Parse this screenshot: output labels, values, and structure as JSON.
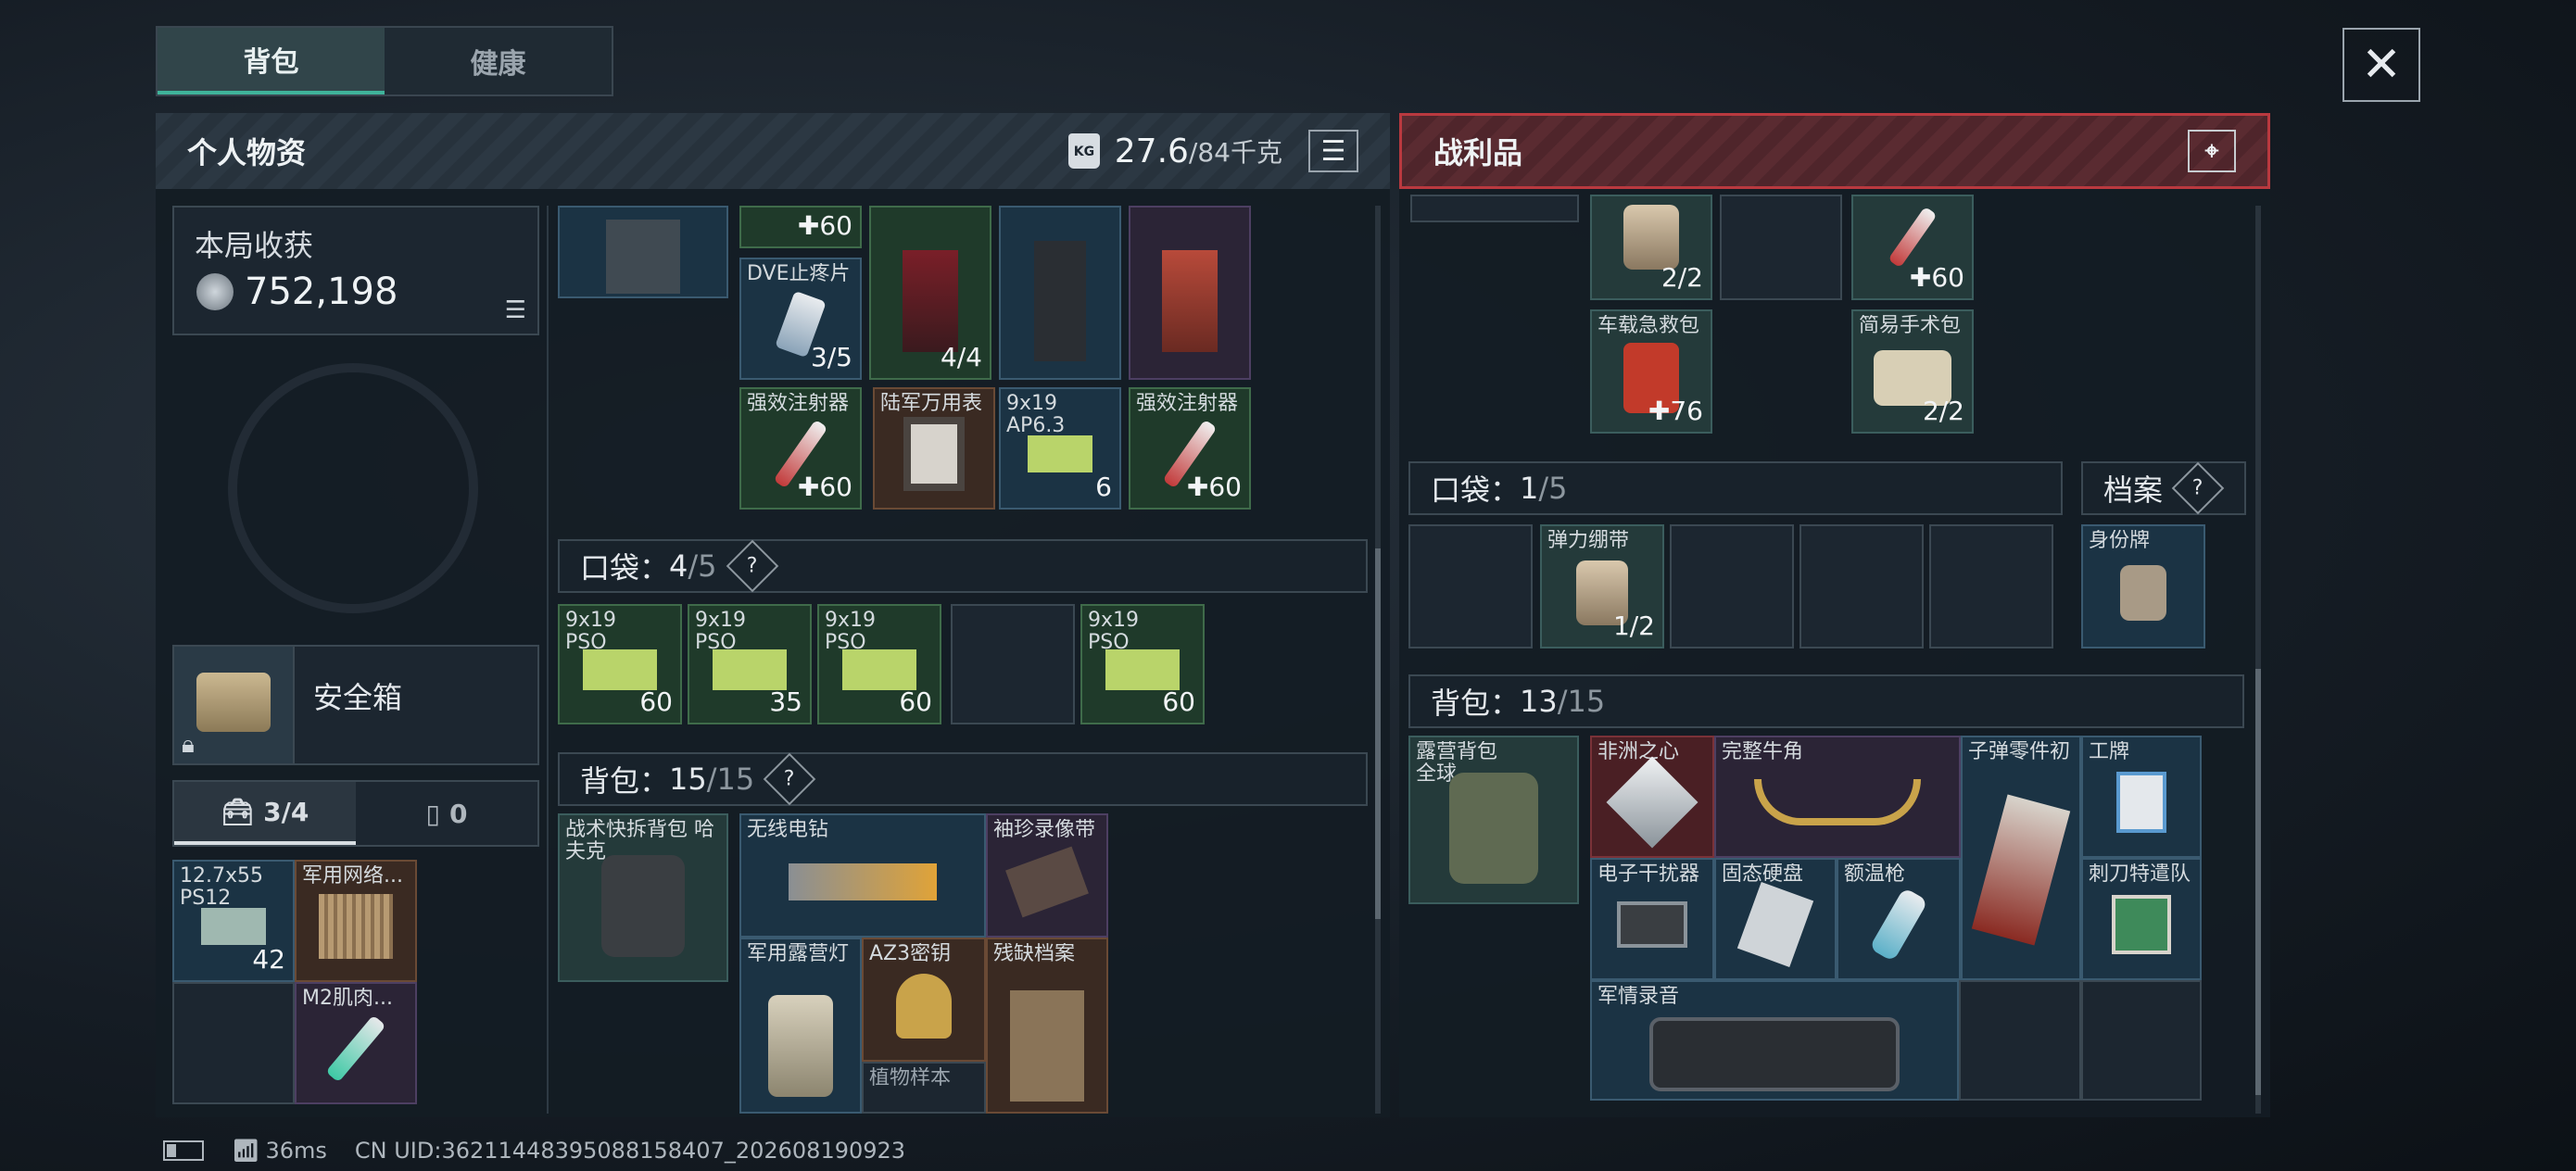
{
  "tabs": [
    {
      "label": "背包"
    },
    {
      "label": "健康"
    }
  ],
  "left_panel": {
    "title": "个人物资",
    "weight_value": "27.6",
    "weight_max": "/84千克"
  },
  "right_panel": {
    "title": "战利品"
  },
  "earnings": {
    "label": "本局收获",
    "value": "752,198"
  },
  "safebox": {
    "label": "安全箱"
  },
  "subtabs": {
    "a": "3/4",
    "b": "0"
  },
  "left_pocket": {
    "label": "口袋：",
    "count": "4",
    "max": "/5"
  },
  "left_backpack": {
    "label": "背包：",
    "count": "15",
    "max": "/15"
  },
  "right_pocket": {
    "label": "口袋：",
    "count": "1",
    "max": "/5"
  },
  "right_archive": {
    "label": "档案"
  },
  "right_backpack": {
    "label": "背包：",
    "count": "13",
    "max": "/15"
  },
  "left_items": [
    {
      "label": "",
      "count": "60"
    },
    {
      "label": "DVE止疼片",
      "count": "3/5"
    },
    {
      "label": "",
      "count": "4/4"
    },
    {
      "label": "强效注射器",
      "count": "60"
    },
    {
      "label": "陆军万用表",
      "count": ""
    },
    {
      "label": "9x19 AP6.3",
      "count": "6"
    },
    {
      "label": "强效注射器",
      "count": "60"
    }
  ],
  "pocket_items": [
    {
      "label": "9x19 PSO",
      "count": "60"
    },
    {
      "label": "9x19 PSO",
      "count": "35"
    },
    {
      "label": "9x19 PSO",
      "count": "60"
    },
    {
      "label": "",
      "count": ""
    },
    {
      "label": "9x19 PSO",
      "count": "60"
    }
  ],
  "backpack_items": [
    {
      "label": "战术快拆背包 哈夫克"
    },
    {
      "label": "无线电钻"
    },
    {
      "label": "袖珍录像带"
    },
    {
      "label": "军用露营灯"
    },
    {
      "label": "AZ3密钥"
    },
    {
      "label": "残缺档案"
    },
    {
      "label": "植物样本"
    }
  ],
  "safe_items": [
    {
      "label": "12.7x55 PS12",
      "count": "42"
    },
    {
      "label": "军用网络...",
      "count": ""
    },
    {
      "label": "M2肌肉...",
      "count": ""
    }
  ],
  "loot_top": [
    {
      "label": "",
      "count": "2/2"
    },
    {
      "label": "",
      "count": "60"
    },
    {
      "label": "车载急救包",
      "count": "76"
    },
    {
      "label": "简易手术包",
      "count": "2/2"
    }
  ],
  "loot_pocket": [
    {
      "label": "弹力绷带",
      "count": "1/2"
    }
  ],
  "loot_archive": [
    {
      "label": "身份牌"
    }
  ],
  "loot_backpack": [
    {
      "label": "露营背包 全球"
    },
    {
      "label": "非洲之心"
    },
    {
      "label": "完整牛角"
    },
    {
      "label": "子弹零件初"
    },
    {
      "label": "工牌"
    },
    {
      "label": "电子干扰器"
    },
    {
      "label": "固态硬盘"
    },
    {
      "label": "额温枪"
    },
    {
      "label": "刺刀特遣队"
    },
    {
      "label": "军情录音"
    }
  ],
  "footer": {
    "ping": "36ms",
    "uid": "CN UID:36211448395088158407_202608190923"
  }
}
